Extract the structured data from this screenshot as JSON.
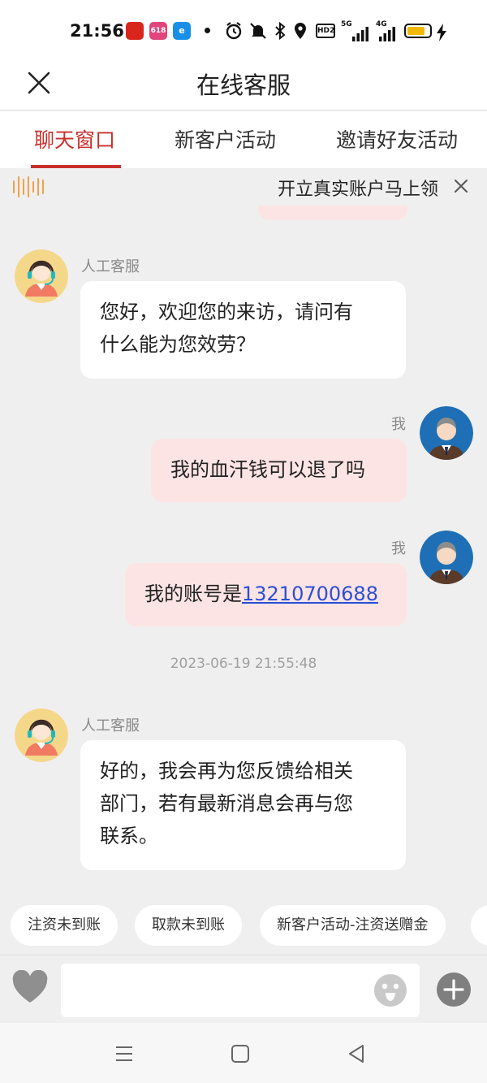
{
  "status_bar": {
    "time": "21:56",
    "icons": [
      "app-icon-1",
      "app-icon-2",
      "app-icon-3",
      "dot",
      "alarm-icon",
      "mute-icon",
      "bluetooth-icon",
      "location-icon",
      "hd-icon",
      "signal-5g-icon",
      "signal-4g-icon",
      "battery-icon",
      "charging-icon"
    ],
    "app_badges": [
      "",
      "618",
      "e"
    ],
    "hd": "HD2",
    "net1": "5G",
    "net2": "4G",
    "battery_level": 0.8,
    "colors": {
      "battery": "#f2b800"
    }
  },
  "header": {
    "title": "在线客服",
    "close_icon": "close-icon"
  },
  "tabs": [
    {
      "label": "聊天窗口",
      "active": true
    },
    {
      "label": "新客户活动",
      "active": false
    },
    {
      "label": "邀请好友活动",
      "active": false
    }
  ],
  "notice": {
    "text": "开立真实账户马上领",
    "icon": "sound-wave-icon"
  },
  "messages": [
    {
      "from": "agent",
      "sender": "人工客服",
      "lines": [
        "您好，欢迎您的来访，请问有",
        "什么能为您效劳？"
      ]
    },
    {
      "from": "me",
      "sender": "我",
      "text": "我的血汗钱可以退了吗"
    },
    {
      "from": "me",
      "sender": "我",
      "text_prefix": "我的账号是",
      "link": "13210700688"
    },
    {
      "timestamp": "2023-06-19 21:55:48"
    },
    {
      "from": "agent",
      "sender": "人工客服",
      "lines": [
        "好的，我会再为您反馈给相关",
        "部门，若有最新消息会再与您",
        "联系。"
      ]
    }
  ],
  "quick_replies": [
    "注资未到账",
    "取款未到账",
    "新客户活动-注资送赠金",
    ""
  ],
  "input": {
    "placeholder": "",
    "value": ""
  },
  "colors": {
    "accent": "#c9302c",
    "my_bubble": "#fde4e4",
    "agent_bubble": "#ffffff",
    "background": "#efefef",
    "link": "#2a4fd6"
  }
}
